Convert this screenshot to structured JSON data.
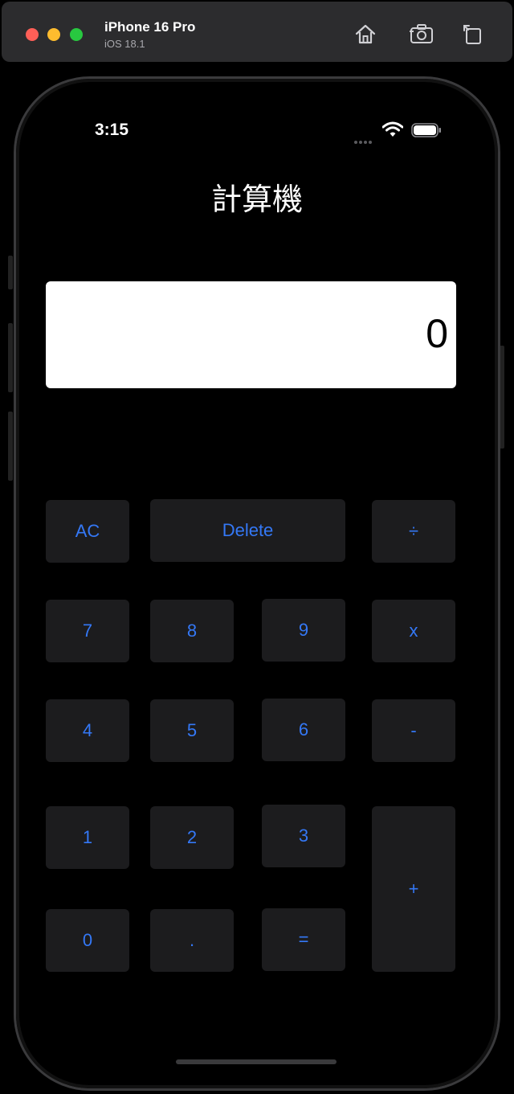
{
  "simulator": {
    "device_name": "iPhone 16 Pro",
    "os_version": "iOS 18.1",
    "buttons": [
      "home-icon",
      "screenshot-icon",
      "rotate-icon"
    ]
  },
  "status_bar": {
    "time": "3:15"
  },
  "app": {
    "title": "計算機",
    "display_value": "0"
  },
  "keypad": {
    "ac": "AC",
    "delete": "Delete",
    "divide": "÷",
    "seven": "7",
    "eight": "8",
    "nine": "9",
    "multiply": "x",
    "four": "4",
    "five": "5",
    "six": "6",
    "minus": "-",
    "one": "1",
    "two": "2",
    "three": "3",
    "plus": "+",
    "zero": "0",
    "dot": ".",
    "equals": "="
  },
  "colors": {
    "key_background": "#1c1c1e",
    "key_text": "#3478f6",
    "display_background": "#ffffff",
    "screen_background": "#000000"
  }
}
